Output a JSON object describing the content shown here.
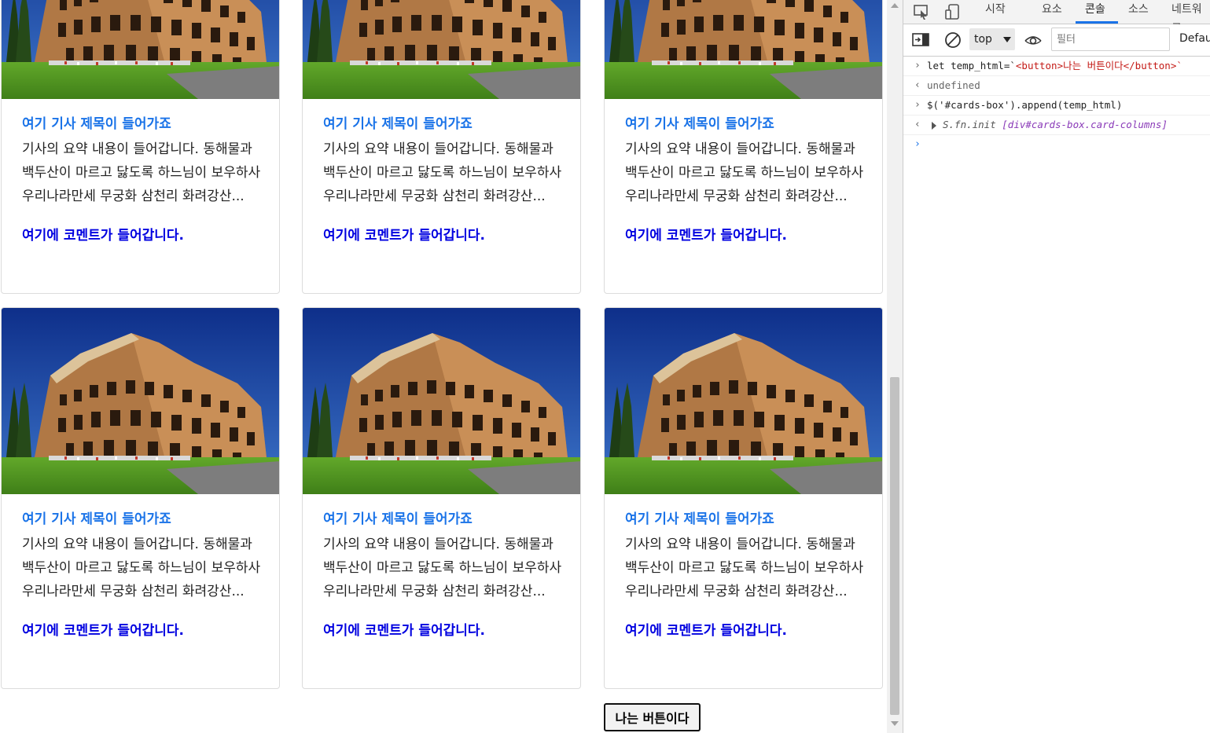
{
  "cards": {
    "title": "여기 기사 제목이 들어가죠",
    "text": "기사의 요약 내용이 들어갑니다. 동해물과 백두산이 마르고 닳도록 하느님이 보우하사 우리나라만세 무궁화 삼천리 화려강산...",
    "comment": "여기에 코멘트가 들어갑니다."
  },
  "page_button_label": "나는 버튼이다",
  "devtools": {
    "tabs": [
      "시작",
      "요소",
      "콘솔",
      "소스",
      "네트워크"
    ],
    "active_tab": "콘솔",
    "context": "top",
    "filter_placeholder": "필터",
    "levels_label": "Default levels",
    "console": [
      {
        "type": "input",
        "prefix": "let temp_html=`",
        "string": "<button>나는 버튼이다</button>`"
      },
      {
        "type": "output",
        "text": "undefined"
      },
      {
        "type": "input",
        "text": "$('#cards-box').append(temp_html)"
      },
      {
        "type": "result",
        "obj": "S.fn.init",
        "cls": "[div#cards-box.card-columns]"
      }
    ]
  },
  "colors": {
    "title": "#1a73e8",
    "comment": "#0000e0",
    "active_tab_underline": "#1a73e8"
  }
}
